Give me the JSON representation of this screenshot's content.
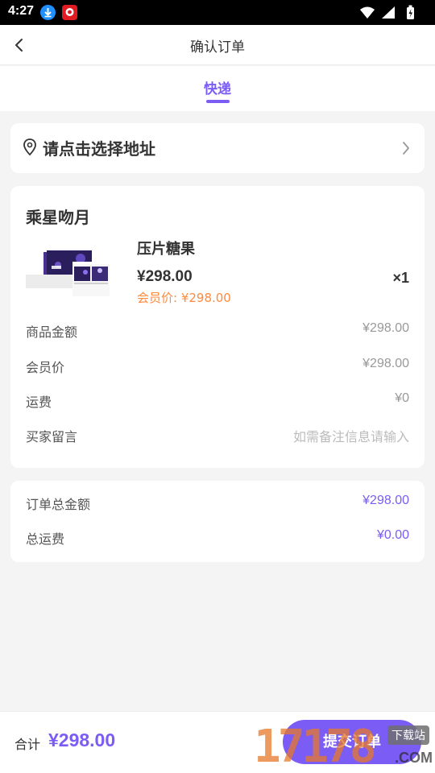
{
  "status_bar": {
    "time": "4:27"
  },
  "header": {
    "title": "确认订单"
  },
  "tabs": [
    {
      "label": "快递",
      "active": true
    }
  ],
  "address": {
    "prompt": "请点击选择地址"
  },
  "order": {
    "shop_name": "乘星吻月",
    "product": {
      "name": "压片糖果",
      "price": "¥298.00",
      "member_price": "会员价: ¥298.00",
      "quantity": "×1"
    },
    "rows": [
      {
        "label": "商品金额",
        "value": "¥298.00"
      },
      {
        "label": "会员价",
        "value": "¥298.00"
      },
      {
        "label": "运费",
        "value": "¥0"
      },
      {
        "label": "买家留言",
        "placeholder": "如需备注信息请输入"
      }
    ]
  },
  "totals": {
    "rows": [
      {
        "label": "订单总金额",
        "value": "¥298.00"
      },
      {
        "label": "总运费",
        "value": "¥0.00"
      }
    ]
  },
  "footer": {
    "total_label": "合计",
    "total_value": "¥298.00",
    "submit_label": "提交订单"
  },
  "watermark": {
    "number": "17178",
    "tag": "下载站",
    "suffix": ".COM"
  },
  "colors": {
    "accent": "#7b5cf5",
    "member_price": "#ff8a3d",
    "background": "#f4f4f5"
  },
  "icons": {
    "back": "chevron-left-icon",
    "location": "location-pin-icon",
    "forward": "chevron-right-icon"
  }
}
